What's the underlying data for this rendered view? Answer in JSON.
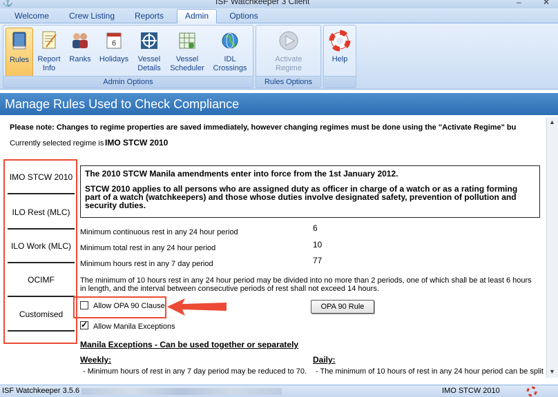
{
  "window": {
    "title": "ISF Watchkeeper 3 Client",
    "minimize": "–",
    "close": "✕"
  },
  "tabs": [
    {
      "label": "Welcome"
    },
    {
      "label": "Crew Listing"
    },
    {
      "label": "Reports"
    },
    {
      "label": "Admin"
    },
    {
      "label": "Options"
    }
  ],
  "ribbon": {
    "admin_group_label": "Admin Options",
    "rules_group_label": "Rules Options",
    "buttons": {
      "rules": "Rules",
      "report_info_1": "Report",
      "report_info_2": "Info",
      "ranks": "Ranks",
      "holidays": "Holidays",
      "vessel_details_1": "Vessel",
      "vessel_details_2": "Details",
      "vessel_scheduler_1": "Vessel",
      "vessel_scheduler_2": "Scheduler",
      "idl_crossings_1": "IDL",
      "idl_crossings_2": "Crossings",
      "activate_regime_1": "Activate",
      "activate_regime_2": "Regime",
      "help": "Help"
    }
  },
  "page": {
    "header": "Manage Rules Used to Check Compliance",
    "note": "Please note: Changes to regime properties are saved immediately, however changing regimes must be done using the \"Activate Regime\" bu",
    "regime_label": "Currently selected regime is",
    "regime_value": "IMO STCW 2010"
  },
  "regimes": [
    {
      "label": "IMO STCW 2010"
    },
    {
      "label": "ILO Rest (MLC)"
    },
    {
      "label": "ILO Work (MLC)"
    },
    {
      "label": "OCIMF"
    },
    {
      "label": "Customised"
    }
  ],
  "info": {
    "line1": "The 2010 STCW Manila amendments enter into force from the 1st January 2012.",
    "line2": "STCW 2010 applies to all persons who are assigned duty as officer in charge of a watch or as a rating forming part of a watch (watchkeepers) and those whose duties involve designated safety, prevention of pollution and security duties."
  },
  "params": [
    {
      "label": "Minimum continuous rest in any 24 hour period",
      "value": "6"
    },
    {
      "label": "Minimum total rest in any 24 hour period",
      "value": "10"
    },
    {
      "label": "Minimum hours rest in any 7 day period",
      "value": "77"
    }
  ],
  "paragraph": "The minimum of 10 hours rest in any 24 hour period may be divided into no more than 2 periods, one of which shall be at least 6 hours in length, and the interval between consecutive periods of rest shall not exceed 14 hours.",
  "options": {
    "opa90_label": "Allow OPA 90 Clause",
    "opa90_checked": false,
    "opa90_button": "OPA 90 Rule",
    "manila_label": "Allow Manila Exceptions",
    "manila_checked": true
  },
  "exceptions": {
    "heading": "Manila Exceptions - Can be used together or separately",
    "weekly_heading": "Weekly:",
    "weekly_text": "- Minimum hours of rest in any 7 day period may be reduced to 70.",
    "daily_heading": "Daily:",
    "daily_text": "- The minimum of 10 hours of rest in any 24 hour period can be split"
  },
  "status": {
    "left": "ISF Watchkeeper 3.5.6",
    "right": "IMO STCW 2010"
  },
  "colors": {
    "highlight": "#ec4a35",
    "header_band": "#2b6db3",
    "ribbon_text": "#15428b"
  }
}
